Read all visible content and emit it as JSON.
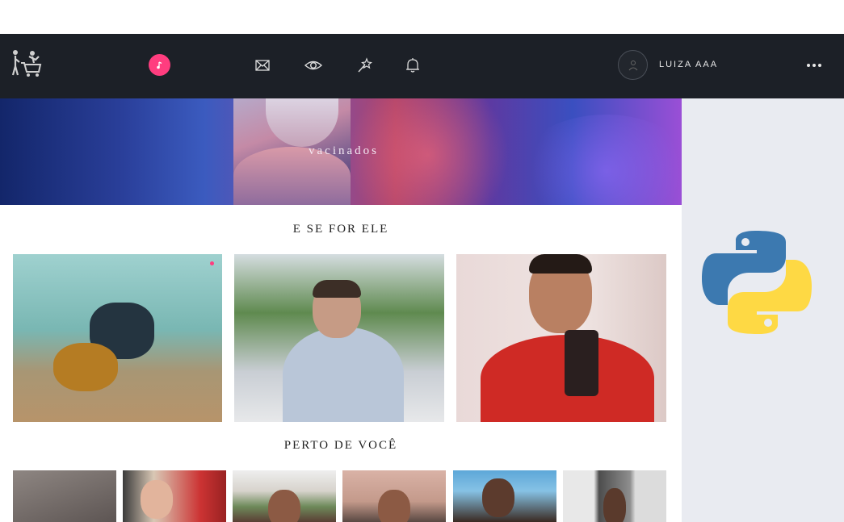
{
  "header": {
    "logo_icon": "shopping-cart-people-logo-icon",
    "nav_icons": [
      "music-note-icon",
      "mail-icon",
      "eye-icon",
      "magic-wand-icon",
      "bell-icon"
    ],
    "user": {
      "name": "LUIZA AAA",
      "avatar_icon": "avatar-icon"
    },
    "more_icon": "more-dots-icon"
  },
  "banner": {
    "text": "vacinados"
  },
  "sections": {
    "featured_title": "E SE FOR ELE",
    "nearby_title": "PERTO DE VOCÊ"
  },
  "sidebar": {
    "logo_icon": "python-logo-icon"
  },
  "colors": {
    "nav_bg": "#1c2027",
    "accent_pink": "#ff3d7f",
    "sidebar_bg": "#e9ebf1"
  }
}
